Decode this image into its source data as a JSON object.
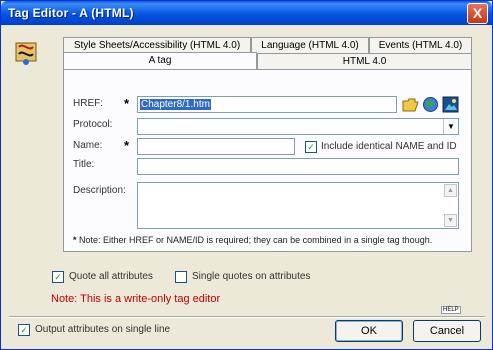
{
  "window": {
    "title": "Tag Editor - A   (HTML)",
    "close_label": "X"
  },
  "icons": {
    "app": "tag-editor-app-icon",
    "folder": "open-folder-icon",
    "globe": "globe-icon",
    "image": "image-icon"
  },
  "tabs": {
    "row_back": [
      "Style Sheets/Accessibility (HTML 4.0)",
      "Language (HTML 4.0)",
      "Events (HTML 4.0)"
    ],
    "row_front": [
      "A tag",
      "HTML 4.0"
    ],
    "active": "A tag"
  },
  "form": {
    "href_label": "HREF:",
    "href_value": "Chapter8/1.htm",
    "protocol_label": "Protocol:",
    "protocol_value": "",
    "name_label": "Name:",
    "name_value": "",
    "include_identical_label": "Include identical NAME and ID",
    "include_identical_checked": true,
    "title_label": "Title:",
    "title_value": "",
    "description_label": "Description:",
    "description_value": "",
    "required_star": "*",
    "note": "Note: Either HREF or NAME/ID is required; they can be combined in a single tag though."
  },
  "options": {
    "quote_all_label": "Quote all attributes",
    "quote_all_checked": true,
    "single_quotes_label": "Single quotes on attributes",
    "single_quotes_checked": false,
    "warning": "Note: This is a write-only tag editor",
    "output_single_line_label": "Output attributes on single line",
    "output_single_line_checked": true
  },
  "help_label": "HELP",
  "buttons": {
    "ok": "OK",
    "cancel": "Cancel"
  },
  "colors": {
    "titlebar": "#0554e3",
    "selection": "#316ac5",
    "warning": "#c00000",
    "window_bg": "#ece9d8"
  }
}
